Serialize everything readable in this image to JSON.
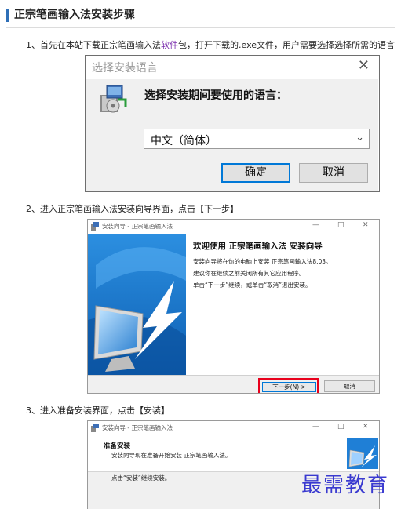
{
  "article": {
    "title": "正宗笔画输入法安装步骤"
  },
  "steps": [
    {
      "text_before_link": "1、首先在本站下载正宗笔画输入法",
      "link_text": "软件",
      "text_after_link": "包，打开下载的.exe文件，用户需要选择选择所需的语言"
    },
    {
      "text": "2、进入正宗笔画输入法安装向导界面，点击【下一步】"
    },
    {
      "text": "3、进入准备安装界面，点击【安装】"
    }
  ],
  "language_dialog": {
    "title": "选择安装语言",
    "close_glyph": "✕",
    "prompt": "选择安装期间要使用的语言：",
    "selected_language": "中文（简体）",
    "ok_label": "确定",
    "cancel_label": "取消"
  },
  "wizard_dialog": {
    "title": "安装向导 - 正宗笔画输入法",
    "window_controls": [
      "—",
      "□",
      "✕"
    ],
    "heading": "欢迎使用 正宗笔画输入法 安装向导",
    "lines": [
      "安装向导将在你的电脑上安装 正宗笔画输入法8.03。",
      "建议你在继续之前关闭所有其它应用程序。",
      "单击“下一步”继续，或单击“取消”退出安装。"
    ],
    "next_label": "下一步(N) >",
    "cancel_label": "取消"
  },
  "ready_dialog": {
    "title": "安装向导 - 正宗笔画输入法",
    "window_controls": [
      "—",
      "□",
      "✕"
    ],
    "heading": "准备安装",
    "subheading": "安装向导现在准备开始安装 正宗笔画输入法。",
    "body": "点击“安装”继续安装。"
  },
  "watermark": "最需教育",
  "colors": {
    "accent": "#2f6fb7",
    "link": "#7b2fae",
    "highlight_box": "#e8001c",
    "focus_border": "#0078d7",
    "watermark": "#3a3ad0"
  },
  "icons": {
    "setup_package": "installer-package-icon",
    "setup_small": "installer-app-icon",
    "wizard_banner": "monitor-arrow-icon",
    "dropdown": "chevron-down-icon"
  }
}
